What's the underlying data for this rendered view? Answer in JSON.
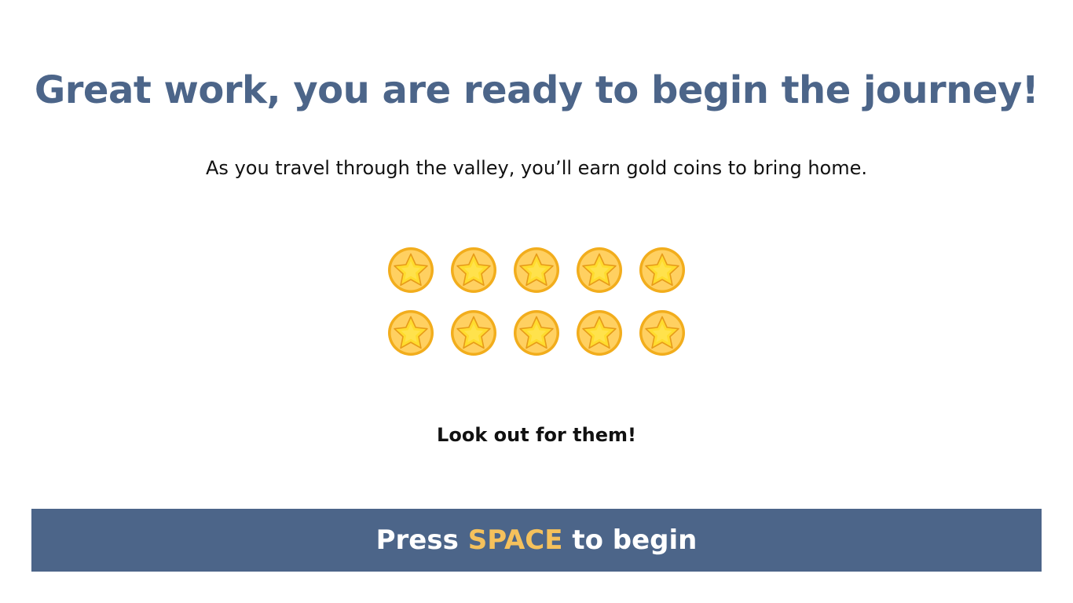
{
  "heading": "Great work, you are ready to begin the journey!",
  "description": "As you travel through the valley, you’ll earn gold coins to bring home.",
  "coins": {
    "icon": "gold-star-coin-icon",
    "rows": 2,
    "per_row": 5,
    "colors": {
      "rim": "#f2ad1c",
      "face": "#ffd061",
      "star": "#ffdc2e",
      "star_edge": "#e79b18"
    }
  },
  "reminder": "Look out for them!",
  "start_prompt": {
    "prefix": "Press",
    "key": "SPACE",
    "suffix": "to begin"
  },
  "colors": {
    "accent": "#4c6589",
    "key_highlight": "#f5c15c",
    "text": "#111111",
    "background": "#ffffff"
  }
}
